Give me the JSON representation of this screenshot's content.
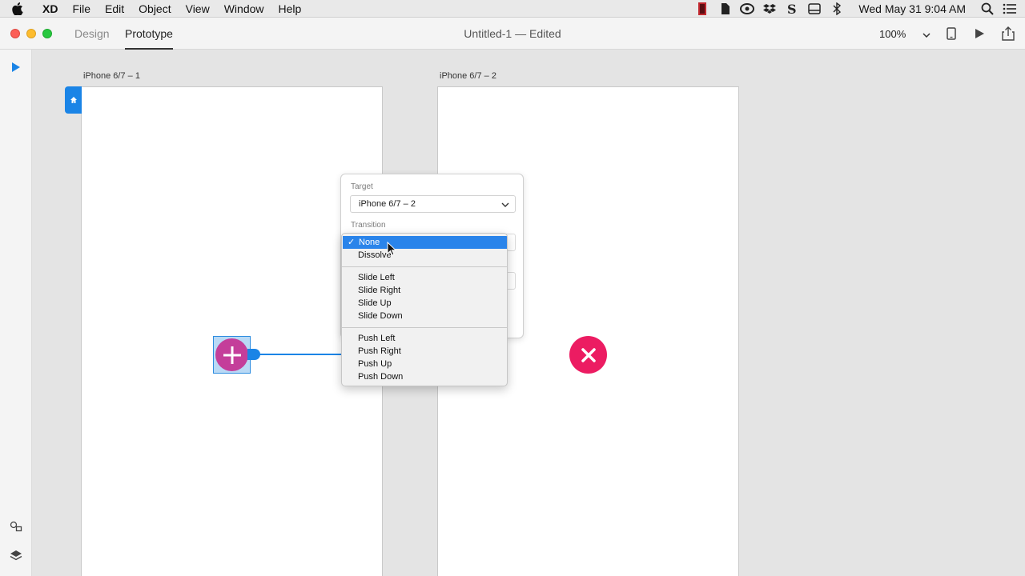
{
  "menubar": {
    "app": "XD",
    "items": [
      "File",
      "Edit",
      "Object",
      "View",
      "Window",
      "Help"
    ],
    "clock": "Wed May 31  9:04 AM"
  },
  "toolbar": {
    "tabs": [
      "Design",
      "Prototype"
    ],
    "active_tab": "Prototype",
    "doc_title": "Untitled-1 — Edited",
    "zoom": "100%"
  },
  "canvas": {
    "artboards": [
      "iPhone 6/7 – 1",
      "iPhone 6/7 – 2"
    ]
  },
  "popover": {
    "target_label": "Target",
    "target_value": "iPhone 6/7 – 2",
    "transition_label": "Transition"
  },
  "dropdown": {
    "selected": "None",
    "groups": [
      [
        "None",
        "Dissolve"
      ],
      [
        "Slide Left",
        "Slide Right",
        "Slide Up",
        "Slide Down"
      ],
      [
        "Push Left",
        "Push Right",
        "Push Up",
        "Push Down"
      ]
    ]
  },
  "colors": {
    "accent": "#1a84e6",
    "selection": "#2a84ea",
    "add_button": "#c43e9a",
    "close_button": "#ec1c62"
  },
  "icons": [
    "apple-icon",
    "search-icon",
    "list-icon",
    "home-icon",
    "play-icon",
    "share-icon",
    "device-icon",
    "select-arrow-icon",
    "assets-icon",
    "layers-icon",
    "plus-icon",
    "close-icon"
  ]
}
